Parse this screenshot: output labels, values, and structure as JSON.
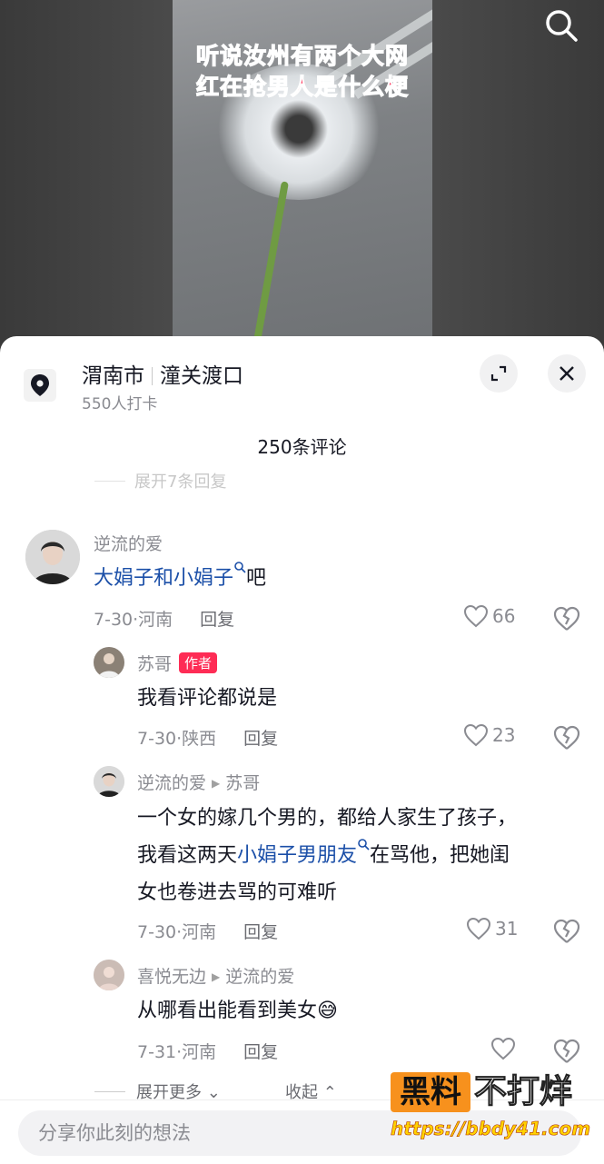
{
  "video": {
    "caption_line1": "听说汝州有两个大网",
    "caption_line2": "红在抢男人是什么梗"
  },
  "location": {
    "city": "渭南市",
    "place": "潼关渡口",
    "checkins": "550人打卡"
  },
  "comments_count": "250条评论",
  "expand_replies_faded": "展开7条回复",
  "comments": [
    {
      "user": "逆流的爱",
      "text_link": "大娟子和小娟子",
      "text_after": "吧",
      "date_region": "7-30·河南",
      "reply": "回复",
      "likes": "66"
    }
  ],
  "replies": [
    {
      "user": "苏哥",
      "badge": "作者",
      "text": "我看评论都说是",
      "date_region": "7-30·陕西",
      "reply": "回复",
      "likes": "23"
    },
    {
      "user": "逆流的爱",
      "reply_to": "苏哥",
      "line1": "一个女的嫁几个男的，都给人家生了孩子，",
      "line2_before": "我看这两天",
      "line2_link": "小娟子男朋友",
      "line2_after": "在骂他，把她闺",
      "line3": "女也卷进去骂的可难听",
      "date_region": "7-30·河南",
      "reply": "回复",
      "likes": "31"
    },
    {
      "user": "喜悦无边",
      "reply_to": "逆流的爱",
      "text": "从哪看出能看到美女",
      "emoji": "😅",
      "date_region": "7-31·河南",
      "reply": "回复",
      "likes": ""
    }
  ],
  "bottom": {
    "expand_more": "展开更多",
    "collapse": "收起"
  },
  "input": {
    "placeholder": "分享你此刻的想法"
  },
  "watermark": {
    "box": "黑料",
    "text": "不打烊",
    "url": "https://bbdy41.com"
  },
  "colors": {
    "accent": "#fe2c55",
    "link": "#1b4fa8",
    "watermark_orange": "#f7911d"
  }
}
